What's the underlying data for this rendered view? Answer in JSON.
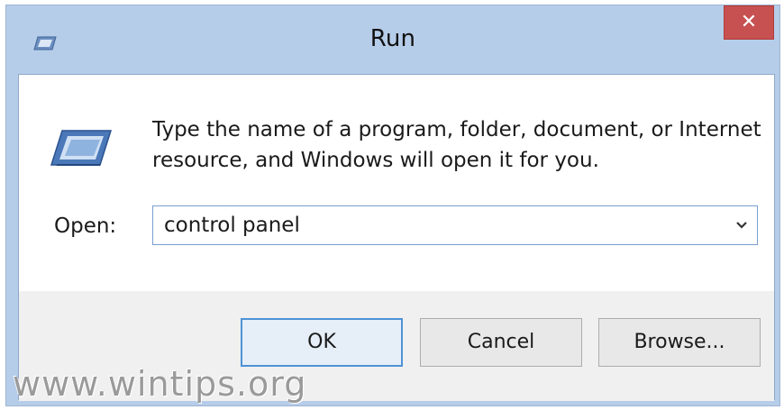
{
  "window": {
    "title": "Run",
    "close_glyph": "✕"
  },
  "description": {
    "line1": "Type the name of a program, folder, document, or Internet",
    "line2": "resource, and Windows will open it for you."
  },
  "open_field": {
    "label": "Open:",
    "value": "control panel"
  },
  "buttons": {
    "ok": "OK",
    "cancel": "Cancel",
    "browse": "Browse..."
  },
  "watermark": "www.wintips.org",
  "icons": {
    "title_icon": "run-window-icon",
    "main_icon": "run-program-icon",
    "dropdown": "chevron-down-icon"
  },
  "colors": {
    "frame": "#b6cde9",
    "close": "#c75050",
    "default_button_border": "#4f92d6"
  }
}
